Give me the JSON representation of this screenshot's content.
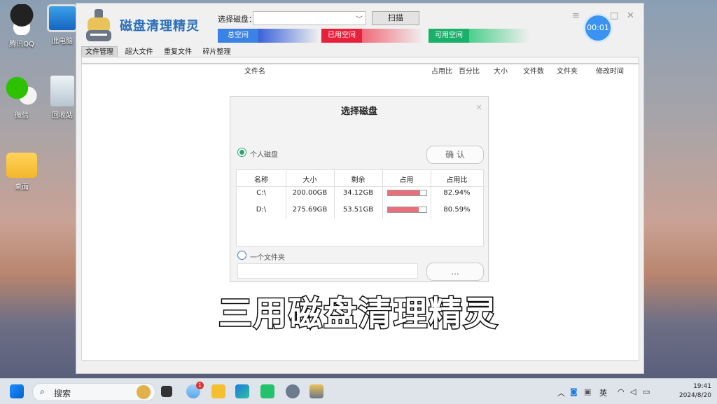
{
  "desktop": {
    "icons": [
      {
        "label": "腾讯QQ"
      },
      {
        "label": "此电脑"
      },
      {
        "label": "微信"
      },
      {
        "label": "回收站"
      },
      {
        "label": "桌面"
      }
    ]
  },
  "app": {
    "title": "磁盘清理精灵",
    "drive_label": "选择磁盘：",
    "drive_value": "",
    "scan_button": "扫描",
    "bars": {
      "total": "总空间",
      "used": "已用空间",
      "free": "可用空间"
    },
    "timer": "00:01",
    "tabs": [
      "文件管理",
      "超大文件",
      "重复文件",
      "碎片整理"
    ],
    "columns": [
      "文件名",
      "占用比",
      "百分比",
      "大小",
      "文件数",
      "文件夹",
      "修改时间"
    ],
    "colors": {
      "accent": "#2a6fb8",
      "total": "#3b82e6",
      "used": "#e8203c",
      "free": "#18b06a"
    }
  },
  "dialog": {
    "title": "选择磁盘",
    "close": "×",
    "option_personal": "个人磁盘",
    "option_folder": "一个文件夹",
    "confirm": "确 认",
    "browse": "...",
    "headers": [
      "名称",
      "大小",
      "剩余",
      "占用",
      "占用比"
    ],
    "rows": [
      {
        "name": "C:\\",
        "size": "200.00GB",
        "free": "34.12GB",
        "usage": 0.8294,
        "ratio": "82.94%"
      },
      {
        "name": "D:\\",
        "size": "275.69GB",
        "free": "53.51GB",
        "usage": 0.8059,
        "ratio": "80.59%"
      }
    ]
  },
  "caption": "三用磁盘清理精灵",
  "taskbar": {
    "search": "搜索",
    "badge": "1",
    "ime": "英",
    "time": "19:41",
    "date": "2024/8/20"
  }
}
